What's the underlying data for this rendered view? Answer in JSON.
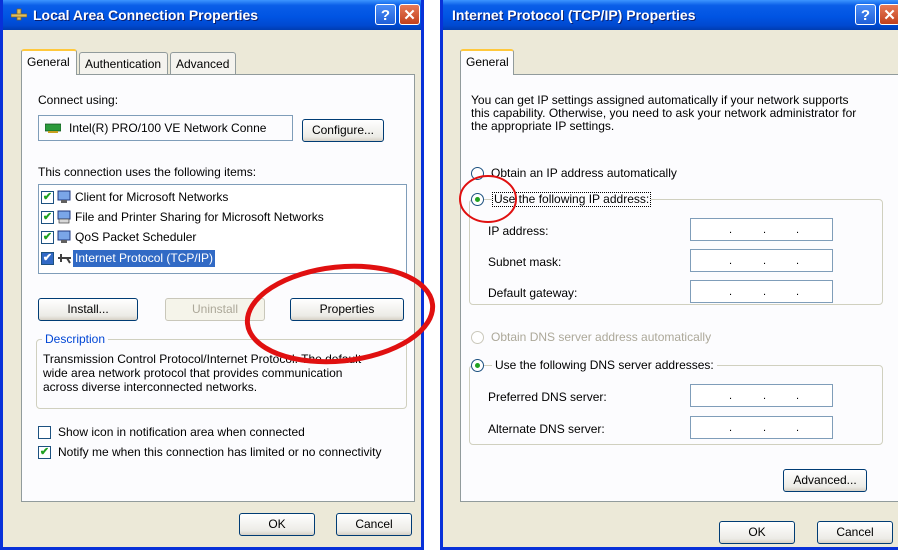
{
  "left_window": {
    "title": "Local Area Connection Properties",
    "tabs": [
      "General",
      "Authentication",
      "Advanced"
    ],
    "connect_using_label": "Connect using:",
    "adapter_name": "Intel(R) PRO/100 VE Network Conne",
    "configure_button": "Configure...",
    "items_label": "This connection uses the following items:",
    "items": [
      {
        "label": "Client for Microsoft Networks",
        "checked": true,
        "icon": "network-client-icon"
      },
      {
        "label": "File and Printer Sharing for Microsoft Networks",
        "checked": true,
        "icon": "file-printer-sharing-icon"
      },
      {
        "label": "QoS Packet Scheduler",
        "checked": true,
        "icon": "qos-scheduler-icon"
      },
      {
        "label": "Internet Protocol (TCP/IP)",
        "checked": true,
        "selected": true,
        "icon": "protocol-icon"
      }
    ],
    "install_button": "Install...",
    "uninstall_button": "Uninstall",
    "properties_button": "Properties",
    "description_legend": "Description",
    "description_text": [
      "Transmission Control Protocol/Internet Protocol. The default",
      "wide area network protocol that provides communication",
      "across diverse interconnected networks."
    ],
    "show_icon_label": "Show icon in notification area when connected",
    "notify_label": "Notify me when this connection has limited or no connectivity",
    "ok_button": "OK",
    "cancel_button": "Cancel"
  },
  "right_window": {
    "title": "Internet Protocol (TCP/IP) Properties",
    "tab": "General",
    "info_text": [
      "You can get IP settings assigned automatically if your network supports",
      "this capability. Otherwise, you need to ask your network administrator for",
      "the appropriate IP settings."
    ],
    "obtain_ip_label": "Obtain an IP address automatically",
    "use_ip_label": "Use the following IP address:",
    "ip_fields": [
      {
        "label": "IP address:"
      },
      {
        "label": "Subnet mask:"
      },
      {
        "label": "Default gateway:"
      }
    ],
    "obtain_dns_label": "Obtain DNS server address automatically",
    "use_dns_label": "Use the following DNS server addresses:",
    "dns_fields": [
      {
        "label": "Preferred DNS server:"
      },
      {
        "label": "Alternate DNS server:"
      }
    ],
    "ip_dot": ".",
    "advanced_button": "Advanced...",
    "ok_button": "OK",
    "cancel_button": "Cancel"
  },
  "colors": {
    "annotation_red": "#e01010",
    "titlebar_blue": "#0054e3",
    "dialog_bg": "#ece9d8",
    "selection_blue": "#316ac5"
  }
}
